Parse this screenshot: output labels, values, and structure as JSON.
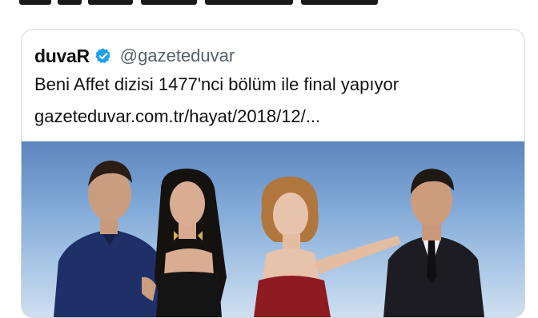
{
  "tweet": {
    "display_name": "duvaR",
    "handle": "@gazeteduvar",
    "text": "Beni Affet dizisi 1477'nci bölüm ile final yapıyor",
    "link": "gazeteduvar.com.tr/hayat/2018/12/..."
  },
  "icons": {
    "verified": "verified-badge-icon"
  },
  "colors": {
    "verified": "#1da1f2",
    "border": "#d6d6d6",
    "handle": "#586069"
  }
}
